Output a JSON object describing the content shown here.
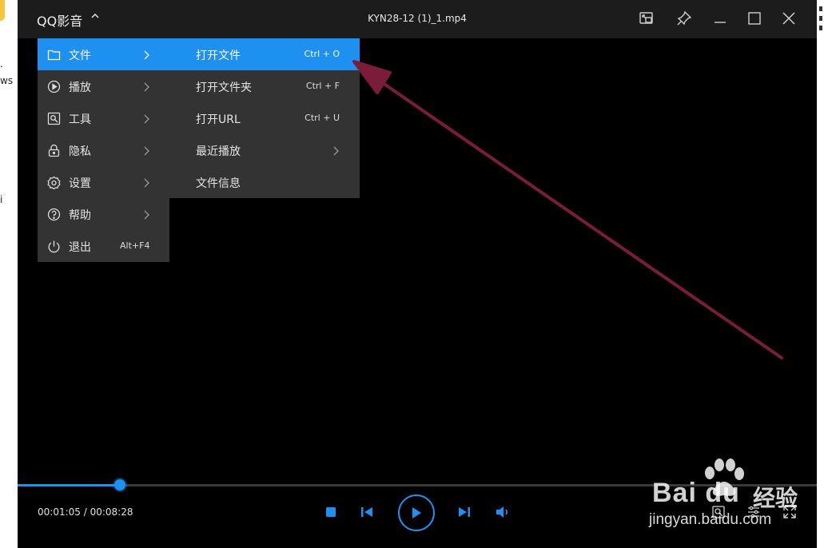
{
  "desktop": {
    "left_fragments": [
      ".",
      "ws",
      "i"
    ]
  },
  "window": {
    "app_title": "QQ影音",
    "app_title_caret": "^",
    "file_name": "KYN28-12 (1)_1.mp4",
    "title_buttons": [
      "mini-player-icon",
      "pin-icon",
      "minimize-icon",
      "maximize-icon",
      "close-icon"
    ]
  },
  "menu": {
    "items": [
      {
        "label": "文件",
        "icon": "folder-icon",
        "has_submenu": true,
        "active": true
      },
      {
        "label": "播放",
        "icon": "play-circle-icon",
        "has_submenu": true
      },
      {
        "label": "工具",
        "icon": "tools-icon",
        "has_submenu": true
      },
      {
        "label": "隐私",
        "icon": "lock-icon",
        "has_submenu": true
      },
      {
        "label": "设置",
        "icon": "gear-icon",
        "has_submenu": true
      },
      {
        "label": "帮助",
        "icon": "help-icon",
        "has_submenu": true
      },
      {
        "label": "退出",
        "icon": "power-icon",
        "shortcut": "Alt+F4"
      }
    ]
  },
  "submenu": {
    "items": [
      {
        "label": "打开文件",
        "shortcut": "Ctrl + O",
        "active": true
      },
      {
        "label": "打开文件夹",
        "shortcut": "Ctrl + F"
      },
      {
        "label": "打开URL",
        "shortcut": "Ctrl + U"
      },
      {
        "label": "最近播放",
        "has_submenu": true
      },
      {
        "label": "文件信息"
      }
    ]
  },
  "playback": {
    "current_time": "00:01:05",
    "total_time": "00:08:28",
    "time_display": "00:01:05 / 00:08:28",
    "progress_fraction": 0.128
  },
  "controls": [
    "stop-icon",
    "previous-icon",
    "play-icon",
    "next-icon",
    "volume-icon"
  ],
  "watermark": {
    "brand": "Bai du",
    "brand_cn": "经验",
    "site": "jingyan.baidu.com"
  },
  "colors": {
    "accent": "#1e90f0",
    "annotation_arrow": "#7a1c3a",
    "menu_bg": "#333333",
    "titlebar_bg": "#1c1c1c",
    "video_bg": "#000000"
  }
}
